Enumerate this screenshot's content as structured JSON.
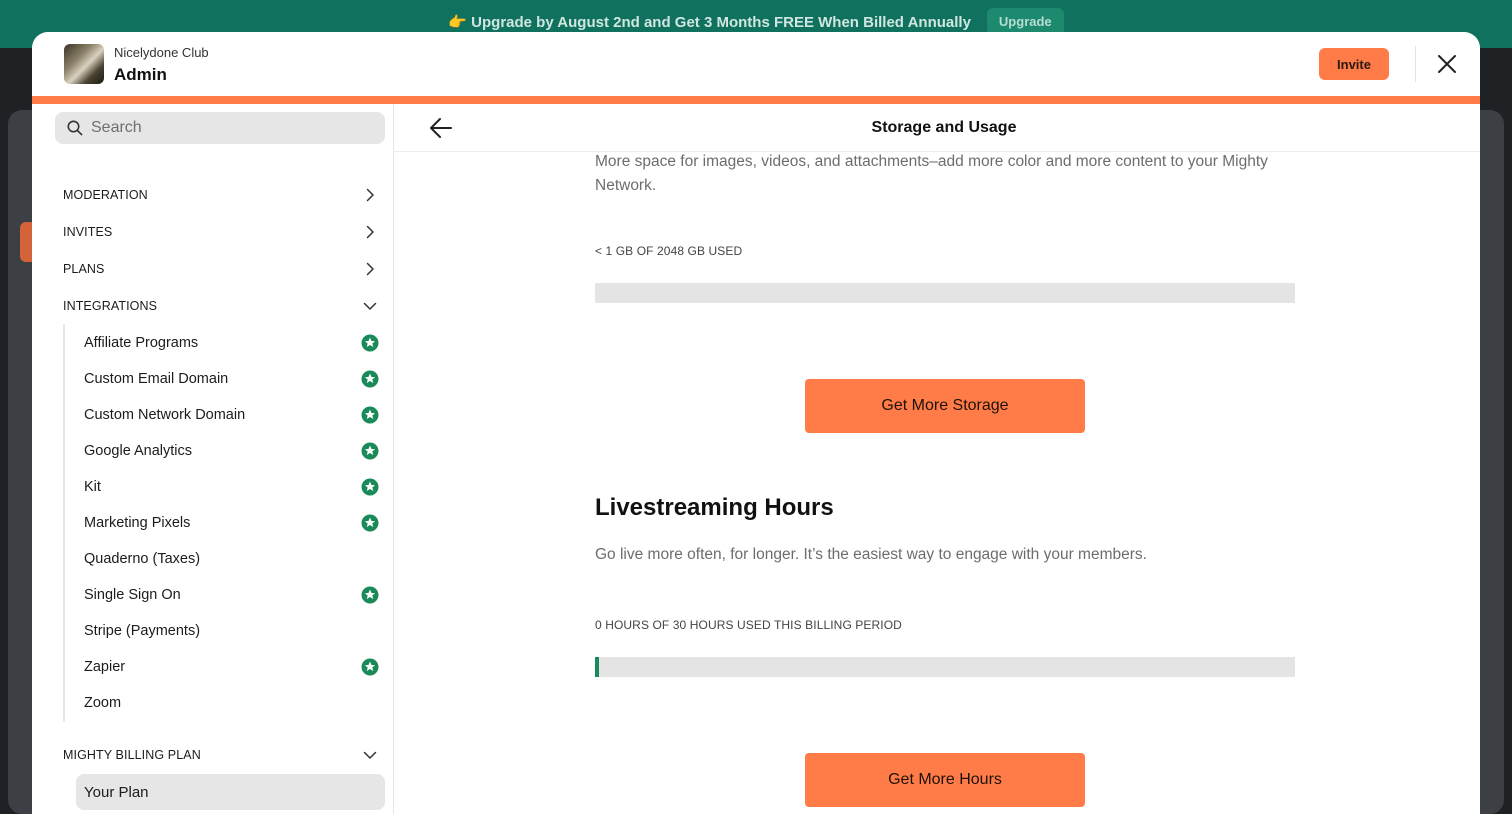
{
  "banner": {
    "text": "👉 Upgrade by August 2nd and Get 3 Months FREE When Billed Annually",
    "button_label": "Upgrade"
  },
  "header": {
    "network_name": "Nicelydone Club",
    "title": "Admin",
    "invite_label": "Invite"
  },
  "sidebar": {
    "search_placeholder": "Search",
    "sections": [
      {
        "label": "MODERATION",
        "state": "collapsed"
      },
      {
        "label": "INVITES",
        "state": "collapsed"
      },
      {
        "label": "PLANS",
        "state": "collapsed"
      },
      {
        "label": "INTEGRATIONS",
        "state": "expanded"
      }
    ],
    "integrations": [
      {
        "label": "Affiliate Programs",
        "premium": true
      },
      {
        "label": "Custom Email Domain",
        "premium": true
      },
      {
        "label": "Custom Network Domain",
        "premium": true
      },
      {
        "label": "Google Analytics",
        "premium": true
      },
      {
        "label": "Kit",
        "premium": true
      },
      {
        "label": "Marketing Pixels",
        "premium": true
      },
      {
        "label": "Quaderno (Taxes)",
        "premium": false
      },
      {
        "label": "Single Sign On",
        "premium": true
      },
      {
        "label": "Stripe (Payments)",
        "premium": false
      },
      {
        "label": "Zapier",
        "premium": true
      },
      {
        "label": "Zoom",
        "premium": false
      }
    ],
    "billing_section": {
      "label": "MIGHTY BILLING PLAN",
      "state": "expanded"
    },
    "billing_items": [
      {
        "label": "Your Plan",
        "selected": true
      }
    ]
  },
  "main": {
    "title": "Storage and Usage",
    "storage": {
      "intro": "More space for images, videos, and attachments–add more color and more content to your Mighty Network.",
      "usage_label": "< 1 GB OF 2048 GB USED",
      "usage_fraction": 0,
      "button_label": "Get More Storage"
    },
    "livestream": {
      "heading": "Livestreaming Hours",
      "description": "Go live more often, for longer. It’s the easiest way to engage with your members.",
      "usage_label": "0 HOURS OF 30 HOURS USED THIS BILLING PERIOD",
      "usage_fraction": 0.005,
      "button_label": "Get More Hours"
    }
  },
  "colors": {
    "accent": "#ff7b47",
    "premium_badge": "#1a8a5a",
    "banner": "#10715f"
  }
}
